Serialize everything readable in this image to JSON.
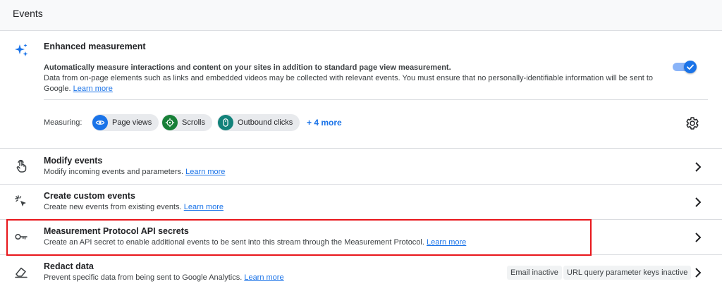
{
  "header": {
    "title": "Events"
  },
  "enhanced": {
    "icon": "sparkle-icon",
    "title": "Enhanced measurement",
    "desc_bold": "Automatically measure interactions and content on your sites in addition to standard page view measurement.",
    "desc_text": "Data from on-page elements such as links and embedded videos may be collected with relevant events. You must ensure that no personally-identifiable information will be sent to Google.",
    "learn_more": "Learn more",
    "toggle_on": true,
    "measuring_label": "Measuring:",
    "chips": [
      {
        "label": "Page views",
        "icon": "eye-icon",
        "color": "#1a73e8"
      },
      {
        "label": "Scrolls",
        "icon": "crosshair-icon",
        "color": "#188038"
      },
      {
        "label": "Outbound clicks",
        "icon": "mouse-icon",
        "color": "#12827a"
      }
    ],
    "more_label": "+ 4 more"
  },
  "rows": [
    {
      "title": "Modify events",
      "desc": "Modify incoming events and parameters.",
      "learn_more": "Learn more",
      "icon": "touch-icon"
    },
    {
      "title": "Create custom events",
      "desc": "Create new events from existing events.",
      "learn_more": "Learn more",
      "icon": "click-icon"
    },
    {
      "title": "Measurement Protocol API secrets",
      "desc": "Create an API secret to enable additional events to be sent into this stream through the Measurement Protocol.",
      "learn_more": "Learn more",
      "icon": "key-icon"
    },
    {
      "title": "Redact data",
      "desc": "Prevent specific data from being sent to Google Analytics.",
      "learn_more": "Learn more",
      "icon": "eraser-icon",
      "badges": [
        "Email inactive",
        "URL query parameter keys inactive"
      ]
    }
  ],
  "colors": {
    "accent": "#1a73e8",
    "highlight": "#e8161b",
    "divider": "#dadce0"
  }
}
